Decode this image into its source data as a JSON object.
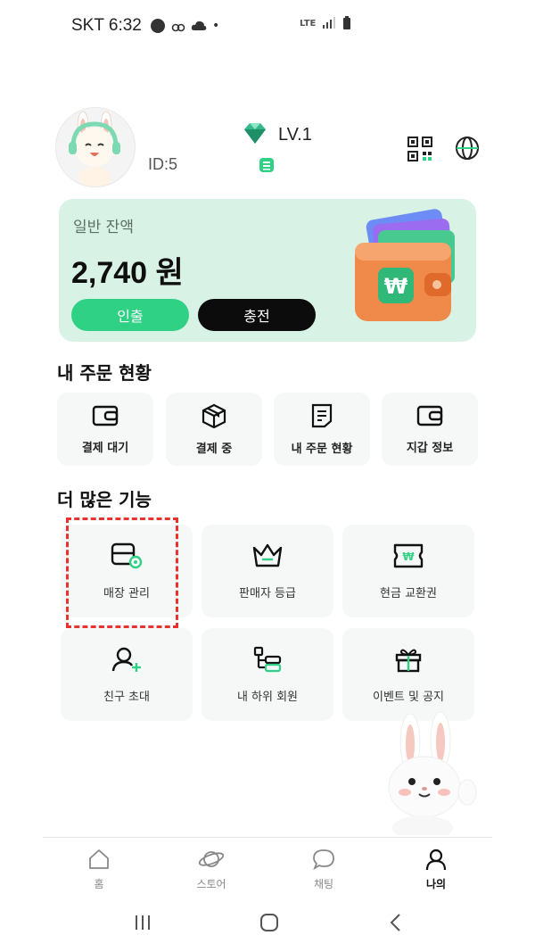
{
  "status_bar": {
    "carrier_time": "SKT 6:32",
    "dot": "•",
    "network": "LTE"
  },
  "profile": {
    "user_id": "ID:5",
    "level": "LV.1"
  },
  "balance": {
    "label": "일반 잔액",
    "amount": "2,740 원",
    "withdraw_label": "인출",
    "charge_label": "충전",
    "wallet_symbol": "₩"
  },
  "orders": {
    "title": "내 주문 현황",
    "items": [
      {
        "label": "결제 대기",
        "icon": "wallet-icon"
      },
      {
        "label": "결제 중",
        "icon": "box-icon"
      },
      {
        "label": "내 주문 현황",
        "icon": "document-icon"
      },
      {
        "label": "지갑 정보",
        "icon": "wallet-icon"
      }
    ]
  },
  "features": {
    "title": "더 많은 기능",
    "items": [
      {
        "label": "매장 관리",
        "icon": "store-manage-icon"
      },
      {
        "label": "판매자 등급",
        "icon": "crown-icon"
      },
      {
        "label": "현금 교환권",
        "icon": "voucher-icon"
      },
      {
        "label": "친구 초대",
        "icon": "invite-user-icon"
      },
      {
        "label": "내 하위 회원",
        "icon": "hierarchy-icon"
      },
      {
        "label": "이벤트 및 공지",
        "icon": "gift-icon"
      }
    ]
  },
  "bottom_nav": {
    "items": [
      {
        "label": "홈",
        "icon": "home-icon"
      },
      {
        "label": "스토어",
        "icon": "planet-icon"
      },
      {
        "label": "채팅",
        "icon": "chat-icon"
      },
      {
        "label": "나의",
        "icon": "person-icon"
      }
    ]
  },
  "colors": {
    "accent": "#2fd184",
    "card_bg": "#d8f3e6",
    "tile_bg": "#f6f7f7",
    "highlight": "#e8322d"
  }
}
